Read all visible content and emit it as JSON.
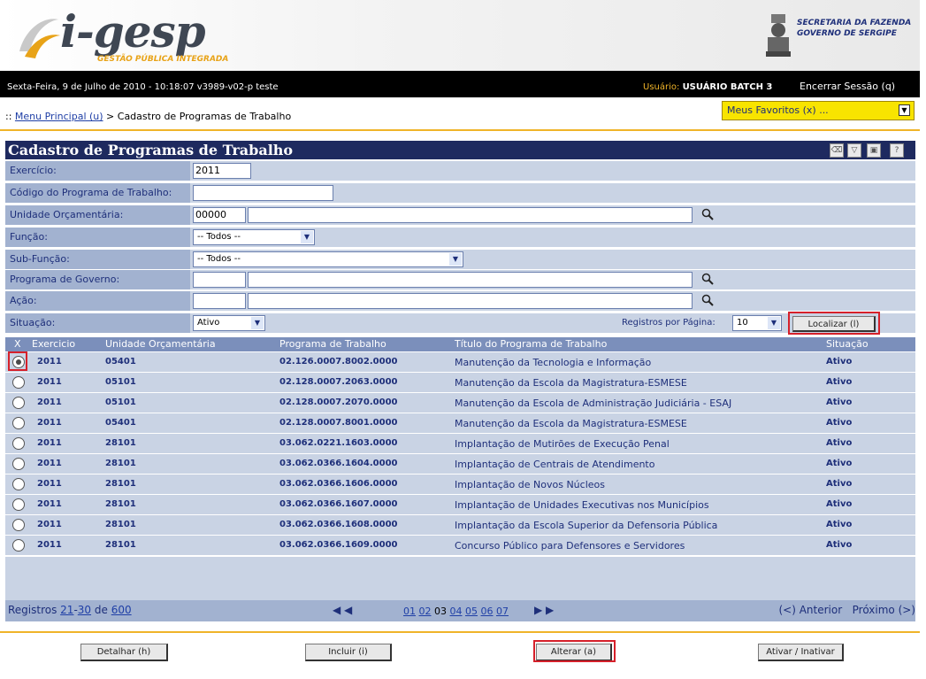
{
  "header": {
    "logo_text": "i-gesp",
    "logo_subtitle": "GESTÃO PÚBLICA INTEGRADA",
    "gov_line1": "SECRETARIA DA FAZENDA",
    "gov_line2": "GOVERNO DE SERGIPE"
  },
  "infobar": {
    "date_text": "Sexta-Feira, 9 de Julho de 2010 - 10:18:07   v3989-v02-p  teste",
    "user_label": "Usuário:",
    "user_value": "USUÁRIO BATCH 3",
    "logout_label": "Encerrar Sessão (q)"
  },
  "breadcrumb": {
    "prefix": ":: ",
    "home_link": "Menu Principal (u)",
    "current": " > Cadastro de Programas de Trabalho"
  },
  "favorites": {
    "label": "Meus Favoritos (x) ..."
  },
  "page_title": "Cadastro de Programas de Trabalho",
  "form": {
    "exercicio_label": "Exercício:",
    "exercicio_value": "2011",
    "codigo_label": "Código do Programa de Trabalho:",
    "codigo_value": "",
    "unidade_label": "Unidade Orçamentária:",
    "unidade_code": "00000",
    "unidade_desc": "",
    "funcao_label": "Função:",
    "funcao_value": "-- Todos --",
    "subfuncao_label": "Sub-Função:",
    "subfuncao_value": "-- Todos --",
    "programa_label": "Programa de Governo:",
    "acao_label": "Ação:",
    "situacao_label": "Situação:",
    "situacao_value": "Ativo",
    "registros_label": "Registros por Página:",
    "registros_value": "10",
    "localizar_label": "Localizar (l)"
  },
  "table": {
    "headers": [
      "X",
      "Exercicio",
      "Unidade Orçamentária",
      "Programa de Trabalho",
      "Título do Programa de Trabalho",
      "Situação"
    ],
    "rows": [
      {
        "exercicio": "2011",
        "unidade": "05401",
        "programa": "02.126.0007.8002.0000",
        "titulo": "Manutenção da Tecnologia e Informação",
        "situacao": "Ativo",
        "selected": true
      },
      {
        "exercicio": "2011",
        "unidade": "05101",
        "programa": "02.128.0007.2063.0000",
        "titulo": "Manutenção da Escola da Magistratura-ESMESE",
        "situacao": "Ativo",
        "selected": false
      },
      {
        "exercicio": "2011",
        "unidade": "05101",
        "programa": "02.128.0007.2070.0000",
        "titulo": "Manutenção da Escola de Administração Judiciária - ESAJ",
        "situacao": "Ativo",
        "selected": false
      },
      {
        "exercicio": "2011",
        "unidade": "05401",
        "programa": "02.128.0007.8001.0000",
        "titulo": "Manutenção da Escola da Magistratura-ESMESE",
        "situacao": "Ativo",
        "selected": false
      },
      {
        "exercicio": "2011",
        "unidade": "28101",
        "programa": "03.062.0221.1603.0000",
        "titulo": "Implantação de Mutirões de Execução Penal",
        "situacao": "Ativo",
        "selected": false
      },
      {
        "exercicio": "2011",
        "unidade": "28101",
        "programa": "03.062.0366.1604.0000",
        "titulo": "Implantação de Centrais de Atendimento",
        "situacao": "Ativo",
        "selected": false
      },
      {
        "exercicio": "2011",
        "unidade": "28101",
        "programa": "03.062.0366.1606.0000",
        "titulo": "Implantação de Novos Núcleos",
        "situacao": "Ativo",
        "selected": false
      },
      {
        "exercicio": "2011",
        "unidade": "28101",
        "programa": "03.062.0366.1607.0000",
        "titulo": "Implantação de Unidades Executivas nos Municípios",
        "situacao": "Ativo",
        "selected": false
      },
      {
        "exercicio": "2011",
        "unidade": "28101",
        "programa": "03.062.0366.1608.0000",
        "titulo": "Implantação da Escola Superior da Defensoria Pública",
        "situacao": "Ativo",
        "selected": false
      },
      {
        "exercicio": "2011",
        "unidade": "28101",
        "programa": "03.062.0366.1609.0000",
        "titulo": "Concurso Público para Defensores e Servidores",
        "situacao": "Ativo",
        "selected": false
      }
    ]
  },
  "pager": {
    "registros_prefix": "Registros ",
    "range_start": "21",
    "range_sep": "-",
    "range_end": "30",
    "de": " de ",
    "total": "600",
    "pages": [
      "01",
      "02",
      "03",
      "04",
      "05",
      "06",
      "07"
    ],
    "current_page": "03",
    "prev_label": "(<) Anterior",
    "next_label": "Próximo (>)"
  },
  "buttons": {
    "detalhar": "Detalhar (h)",
    "incluir": "Incluir (i)",
    "alterar": "Alterar (a)",
    "ativar": "Ativar / Inativar"
  },
  "colors": {
    "accent_yellow": "#f0b429",
    "nav_dark": "#1e2a5f",
    "highlight_red": "#d6202a"
  }
}
